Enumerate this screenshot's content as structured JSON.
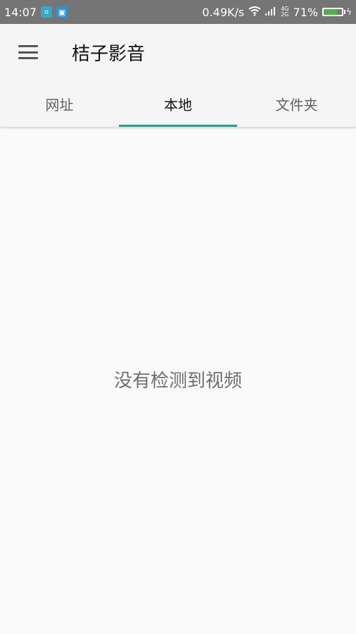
{
  "status_bar": {
    "time": "14:07",
    "network_speed": "0.49K/s",
    "signal_top": "4G",
    "signal_bottom": "2G",
    "battery_percent": "71%",
    "battery_level": 0.71,
    "battery_color": "#4caf50"
  },
  "app_bar": {
    "title": "桔子影音"
  },
  "tabs": [
    {
      "label": "网址",
      "active": false
    },
    {
      "label": "本地",
      "active": true
    },
    {
      "label": "文件夹",
      "active": false
    }
  ],
  "accent_color": "#2a9d8f",
  "main": {
    "empty_message": "没有检测到视频"
  }
}
